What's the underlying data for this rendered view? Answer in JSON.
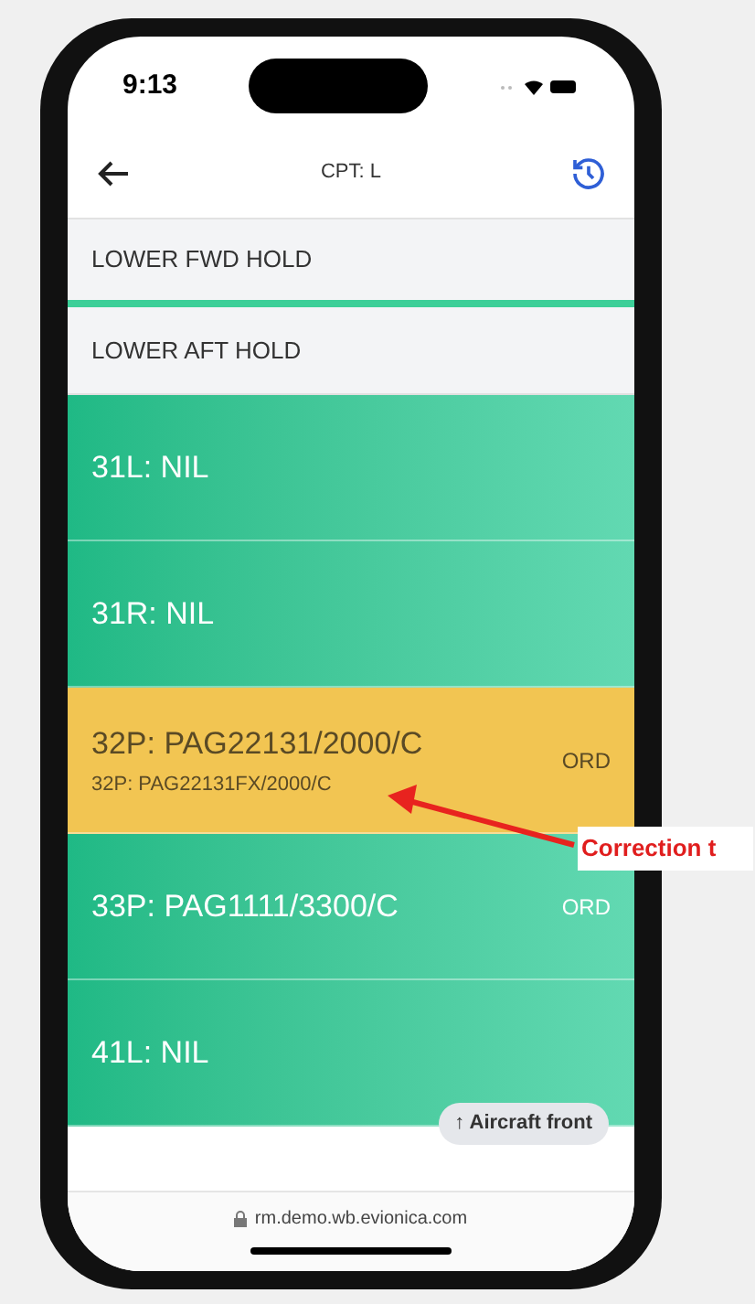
{
  "status_bar": {
    "time": "9:13"
  },
  "header": {
    "title": "CPT: L"
  },
  "sections": [
    {
      "label": "LOWER FWD HOLD",
      "selected": true
    },
    {
      "label": "LOWER AFT HOLD",
      "selected": false
    }
  ],
  "rows": [
    {
      "label": "31L: NIL",
      "highlighted": false
    },
    {
      "label": "31R: NIL",
      "highlighted": false
    },
    {
      "label": "32P: PAG22131/2000/C",
      "sublabel": "32P: PAG22131FX/2000/C",
      "tag": "ORD",
      "highlighted": true
    },
    {
      "label": "33P: PAG1111/3300/C",
      "tag": "ORD",
      "highlighted": false
    },
    {
      "label": "41L: NIL",
      "highlighted": false
    }
  ],
  "pill": {
    "label": "↑ Aircraft front"
  },
  "url_bar": {
    "url": "rm.demo.wb.evionica.com"
  },
  "annotation": {
    "text": "Correction t"
  }
}
